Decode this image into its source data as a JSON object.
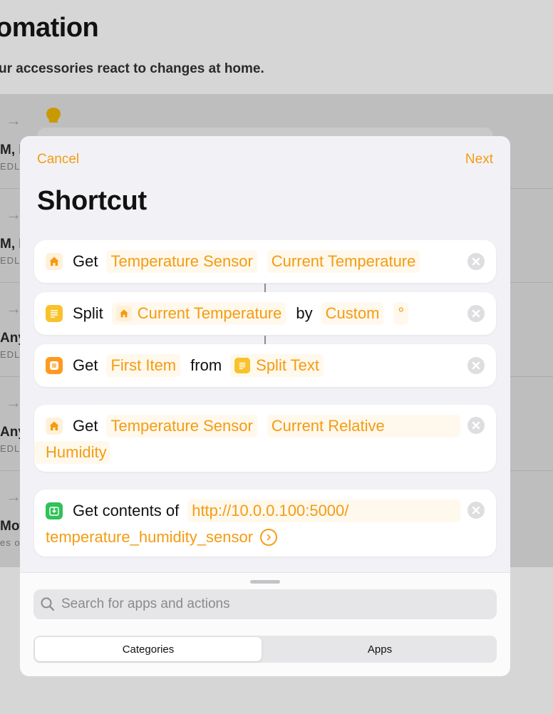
{
  "background": {
    "title": "omation",
    "subtitle": "ur accessories react to changes at home.",
    "rows": [
      {
        "name": "M, D",
        "desc": "EDL"
      },
      {
        "name": "M, D",
        "desc": "EDL"
      },
      {
        "name": "Any",
        "desc": "EDL"
      },
      {
        "name": "Any",
        "desc": "EDL"
      },
      {
        "name": "Mot",
        "desc": "es o"
      }
    ]
  },
  "sheet": {
    "cancel_label": "Cancel",
    "next_label": "Next",
    "title": "Shortcut"
  },
  "actions": {
    "get_temp": {
      "verb": "Get",
      "accessory": "Temperature Sensor",
      "characteristic": "Current Temperature"
    },
    "split": {
      "verb": "Split",
      "input": "Current Temperature",
      "by": "by",
      "separator_type": "Custom",
      "custom_separator": "°"
    },
    "get_item": {
      "verb": "Get",
      "item": "First Item",
      "from": "from",
      "source": "Split Text"
    },
    "get_humidity": {
      "verb": "Get",
      "accessory": "Temperature Sensor",
      "characteristic_line1": "Current Relative",
      "characteristic_line2": "Humidity"
    },
    "get_contents": {
      "verb": "Get contents of",
      "url_line1": "http://10.0.0.100:5000/",
      "url_line2": "temperature_humidity_sensor"
    }
  },
  "panel": {
    "search_placeholder": "Search for apps and actions",
    "tabs": [
      "Categories",
      "Apps"
    ]
  },
  "colors": {
    "accent": "#f39c12",
    "home_icon": "#f39c12",
    "text_icon": "#f9c22a",
    "list_icon": "#ff9a1f",
    "web_icon": "#31c158"
  }
}
